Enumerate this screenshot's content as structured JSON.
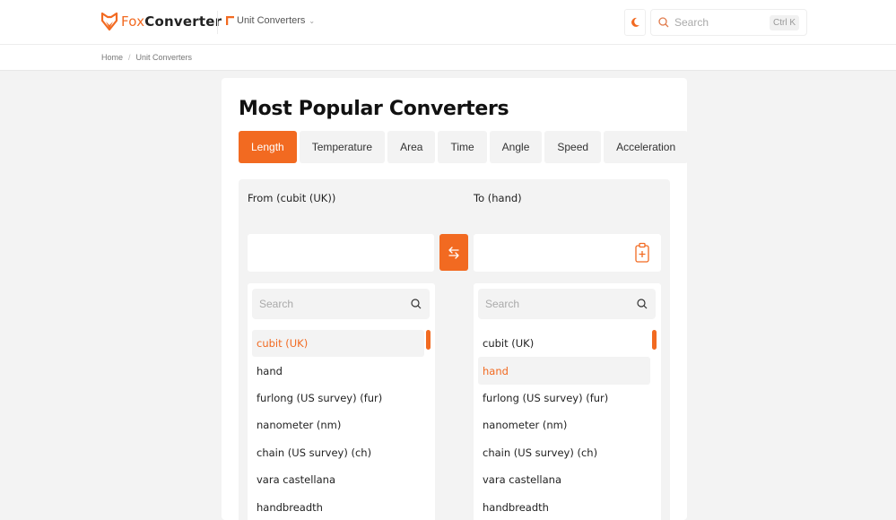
{
  "header": {
    "brand_part1": "Fox",
    "brand_part2": "Converter",
    "nav_menu_label": "Unit Converters",
    "search_placeholder": "Search",
    "search_shortcut": "Ctrl K",
    "accent_color": "#f26a21"
  },
  "breadcrumb": {
    "items": [
      "Home",
      "Unit Converters"
    ],
    "separator": "/"
  },
  "main": {
    "title": "Most Popular Converters",
    "tabs": [
      {
        "label": "Length",
        "active": true
      },
      {
        "label": "Temperature",
        "active": false
      },
      {
        "label": "Area",
        "active": false
      },
      {
        "label": "Time",
        "active": false
      },
      {
        "label": "Angle",
        "active": false
      },
      {
        "label": "Speed",
        "active": false
      },
      {
        "label": "Acceleration",
        "active": false
      }
    ],
    "converter": {
      "from_label": "From (cubit (UK))",
      "to_label": "To (hand)",
      "from_value": "",
      "to_value": "",
      "swap_icon": "swap-arrows-icon",
      "paste_icon": "clipboard-plus-icon",
      "from_list": {
        "search_placeholder": "Search",
        "selected": "cubit (UK)",
        "items": [
          "cubit (UK)",
          "hand",
          "furlong (US survey) (fur)",
          "nanometer (nm)",
          "chain (US survey) (ch)",
          "vara castellana",
          "handbreadth"
        ]
      },
      "to_list": {
        "search_placeholder": "Search",
        "selected": "hand",
        "items": [
          "cubit (UK)",
          "hand",
          "furlong (US survey) (fur)",
          "nanometer (nm)",
          "chain (US survey) (ch)",
          "vara castellana",
          "handbreadth"
        ]
      }
    }
  }
}
